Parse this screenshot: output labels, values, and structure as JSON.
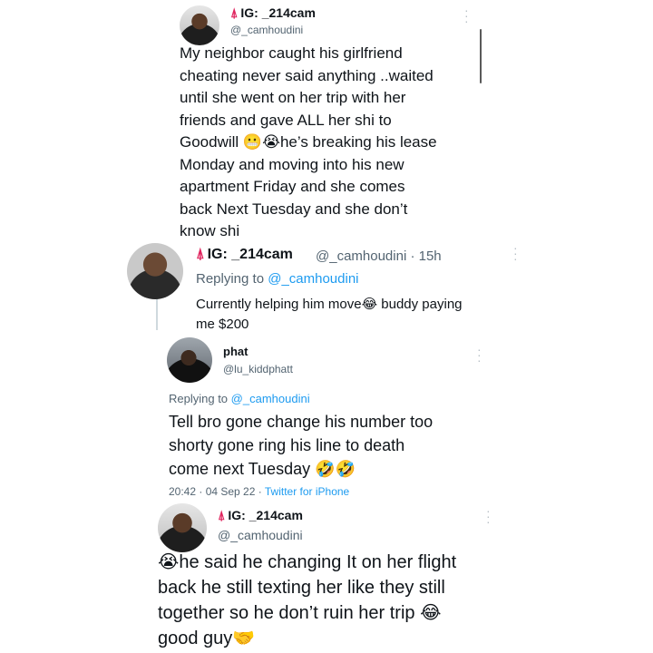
{
  "tweet1": {
    "name": "IG: _214cam",
    "handle": "@_camhoudini",
    "text": "My neighbor caught his girlfriend\ncheating never said anything ..waited\nuntil she went on her trip with her\nfriends and gave ALL her shi to\nGoodwill 😬😭he’s breaking his lease\nMonday and moving into his new\napartment Friday and she comes\nback Next Tuesday and she don’t\nknow shi"
  },
  "tweet2": {
    "name": "IG: _214cam",
    "handle_time": "@_camhoudini · 15h",
    "replying_prefix": "Replying to",
    "replying_handle": "@_camhoudini",
    "text": "Currently helping him move😂 buddy paying\nme $200"
  },
  "tweet3": {
    "name": "phat",
    "handle": "@lu_kiddphatt",
    "replying_prefix": "Replying to",
    "replying_handle": "@_camhoudini",
    "text": "Tell bro gone change his number too\nshorty gone ring his line  to death\ncome next Tuesday 🤣🤣",
    "timestamp": "20:42 · 04 Sep 22 · ",
    "source": "Twitter for iPhone"
  },
  "tweet4": {
    "name": "IG: _214cam",
    "handle": "@_camhoudini",
    "text": "😭he said he changing It on her flight\nback he still texting her like they still\ntogether so he don’t ruin her trip 😂\ngood guy🤝"
  },
  "icons": {
    "tower": "tokyo-tower-icon",
    "more": "more-options-icon"
  },
  "colors": {
    "link": "#1d9bf0",
    "secondary": "#536471",
    "tower": "#e0245e"
  }
}
